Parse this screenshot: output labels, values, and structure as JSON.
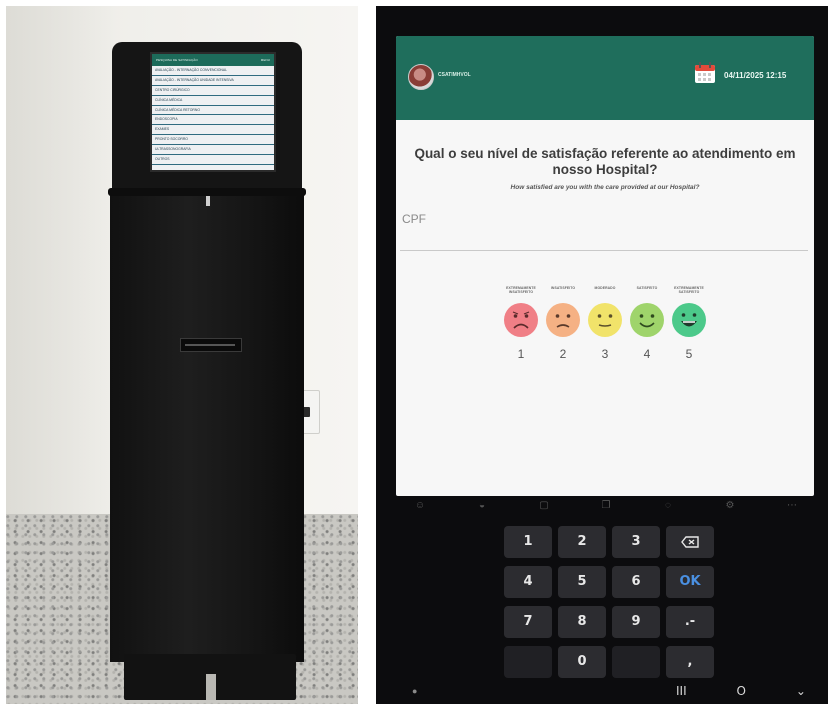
{
  "kiosk_screen": {
    "header_title": "PESQUISA DE SATISFAÇÃO",
    "header_menu": "MENU",
    "items": [
      "AVALIAÇÃO - INTERNAÇÃO CONVENCIONAL",
      "AVALIAÇÃO - INTERNAÇÃO UNIDADE INTENSIVA",
      "CENTRO CIRÚRGICO",
      "CLÍNICA MÉDICA",
      "CLÍNICA MÉDICA RETORNO",
      "ENDOSCOPIA",
      "EXAMES",
      "PRONTO SOCORRO",
      "ULTRASSONOGRAFIA",
      "OUTROS"
    ]
  },
  "tablet_screen": {
    "hospital_name": "CSATIMHVOL",
    "datetime": "04/11/2025 12:15",
    "question_pt": "Qual o seu nível de satisfação referente ao atendimento em nosso Hospital?",
    "question_en": "How satisfied are you with the care provided at our Hospital?",
    "cpf_placeholder": "CPF",
    "ratings": [
      {
        "label": "EXTREMAMENTE INSATISFEITO",
        "number": "1",
        "color": "#f07f86"
      },
      {
        "label": "INSATISFEITO",
        "number": "2",
        "color": "#f5b184"
      },
      {
        "label": "MODERADO",
        "number": "3",
        "color": "#f1e36a"
      },
      {
        "label": "SATISFEITO",
        "number": "4",
        "color": "#9fd46b"
      },
      {
        "label": "EXTREMAMENTE SATISFEITO",
        "number": "5",
        "color": "#4cc98a"
      }
    ]
  },
  "keypad": {
    "keys": [
      "1",
      "2",
      "3",
      "4",
      "5",
      "6",
      "7",
      "8",
      "9",
      "0"
    ],
    "ok_label": "OK",
    "backspace_icon": "backspace-icon",
    "dash_label": ".-",
    "comma_label": ","
  },
  "system_nav": {
    "recent_label": "III",
    "home_label": "O",
    "back_label": "⌄"
  },
  "colors": {
    "header_green": "#1f6e5c",
    "kiosk_black": "#151515",
    "key_bg": "#2c2c30",
    "ok_blue": "#4a90e2"
  }
}
